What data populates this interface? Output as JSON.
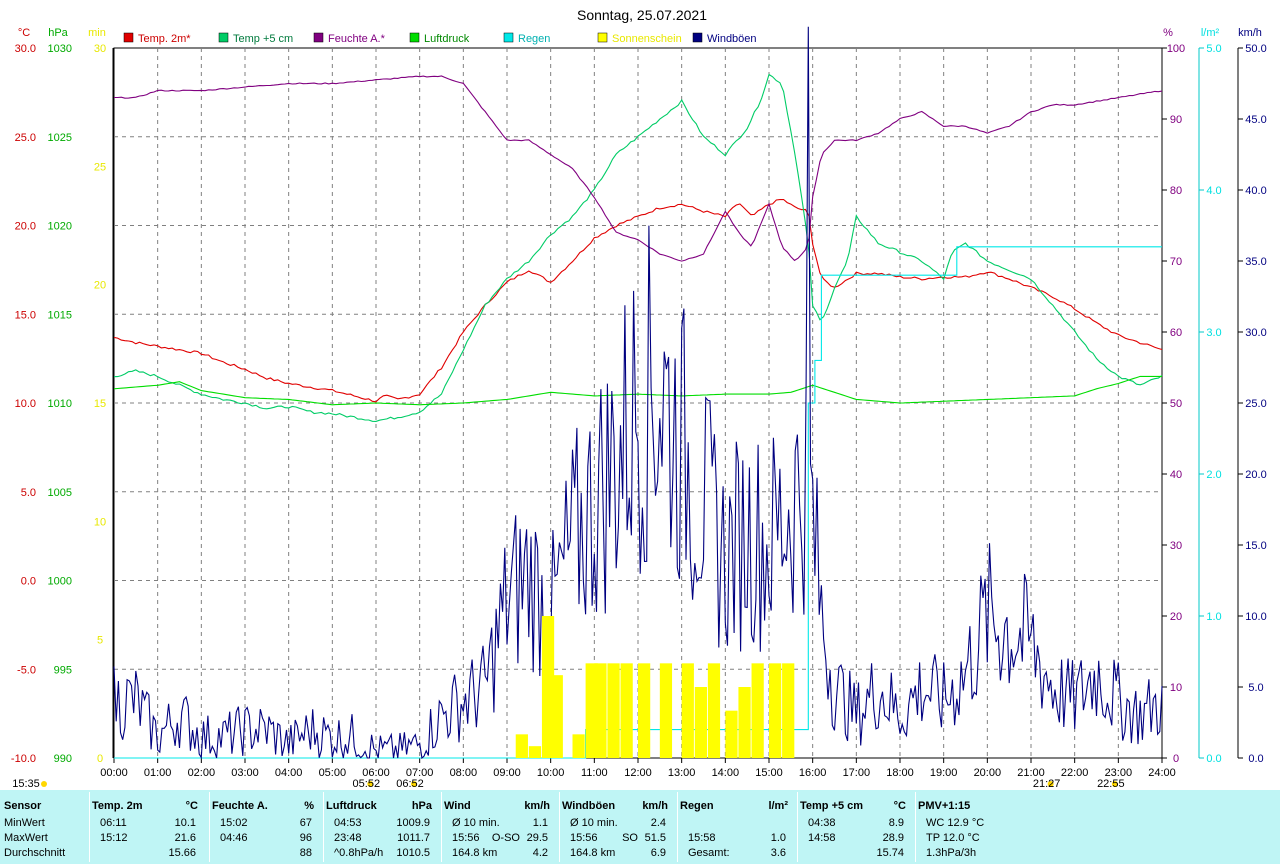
{
  "chart_data": {
    "type": "line",
    "title": "Sonntag, 25.07.2021",
    "x_ticks": [
      "00:00",
      "01:00",
      "02:00",
      "03:00",
      "04:00",
      "05:00",
      "06:00",
      "07:00",
      "08:00",
      "09:00",
      "10:00",
      "11:00",
      "12:00",
      "13:00",
      "14:00",
      "15:00",
      "16:00",
      "17:00",
      "18:00",
      "19:00",
      "20:00",
      "21:00",
      "22:00",
      "23:00",
      "24:00"
    ],
    "axes": {
      "temp_c": {
        "unit": "°C",
        "ylim": [
          -10,
          30
        ],
        "ticks": [
          "30.0",
          "25.0",
          "20.0",
          "15.0",
          "10.0",
          "5.0",
          "0.0",
          "-5.0",
          "-10.0"
        ],
        "color": "#cc0000"
      },
      "pressure_hpa": {
        "unit": "hPa",
        "ylim": [
          990,
          1030
        ],
        "ticks": [
          "1030",
          "1025",
          "1020",
          "1015",
          "1010",
          "1005",
          "1000",
          "995",
          "990"
        ],
        "color": "#00aa00"
      },
      "sunshine_min": {
        "unit": "min",
        "ylim": [
          0,
          30
        ],
        "ticks": [
          "30",
          "25",
          "20",
          "15",
          "10",
          "5",
          "0"
        ],
        "color": "#e8e800"
      },
      "humidity_pct": {
        "unit": "%",
        "ylim": [
          0,
          100
        ],
        "ticks": [
          "100",
          "90",
          "80",
          "70",
          "60",
          "50",
          "40",
          "30",
          "20",
          "10",
          "0"
        ],
        "color": "#800080"
      },
      "rain_lm2": {
        "unit": "l/m²",
        "ylim": [
          0,
          5
        ],
        "ticks": [
          "5.0",
          "4.0",
          "3.0",
          "2.0",
          "1.0",
          "0.0"
        ],
        "color": "#00e0e0"
      },
      "wind_kmh": {
        "unit": "km/h",
        "ylim": [
          0,
          50
        ],
        "ticks": [
          "50.0",
          "45.0",
          "40.0",
          "35.0",
          "30.0",
          "25.0",
          "20.0",
          "15.0",
          "10.0",
          "5.0",
          "0.0"
        ],
        "color": "#000080"
      }
    },
    "legend": [
      {
        "name": "Temp. 2m*",
        "color": "#e00000",
        "label_color": "#cc0000"
      },
      {
        "name": "Temp +5 cm",
        "color": "#00cc66",
        "label_color": "#007a3d"
      },
      {
        "name": "Feuchte A.*",
        "color": "#800080",
        "label_color": "#800080"
      },
      {
        "name": "Luftdruck",
        "color": "#00dd00",
        "label_color": "#008800"
      },
      {
        "name": "Regen",
        "color": "#00e8e8",
        "label_color": "#00b0b0"
      },
      {
        "name": "Sonnenschein",
        "color": "#ffff00",
        "label_color": "#e8e800"
      },
      {
        "name": "Windböen",
        "color": "#000080",
        "label_color": "#000080"
      }
    ],
    "series": [
      {
        "name": "Temp. 2m*",
        "axis": "temp_c",
        "color": "#e00000",
        "x": [
          0,
          0.5,
          1,
          1.5,
          2,
          2.5,
          3,
          3.5,
          4,
          4.5,
          5,
          5.5,
          6,
          6.2,
          6.5,
          7,
          7.5,
          8,
          8.5,
          9,
          9.5,
          10,
          10.5,
          11,
          11.5,
          12,
          12.5,
          13,
          13.5,
          14,
          14.3,
          14.6,
          15,
          15.3,
          15.6,
          15.9,
          16,
          16.2,
          16.5,
          17,
          17.5,
          18,
          18.5,
          19,
          19.5,
          20,
          20.5,
          21,
          21.5,
          22,
          22.5,
          23,
          23.5,
          24
        ],
        "y": [
          13.7,
          13.4,
          13.2,
          13.0,
          12.8,
          12.3,
          11.9,
          11.4,
          11.1,
          10.9,
          10.7,
          10.4,
          10.1,
          10.4,
          10.2,
          10.5,
          12.0,
          14.0,
          15.5,
          16.8,
          17.5,
          16.8,
          18.0,
          19.3,
          20.0,
          20.5,
          21.0,
          21.2,
          20.8,
          20.5,
          21.3,
          20.5,
          21.2,
          21.5,
          21.0,
          20.8,
          19.0,
          17.0,
          16.5,
          17.3,
          17.3,
          17.1,
          17.0,
          17.1,
          17.1,
          17.4,
          17.0,
          16.5,
          16.0,
          15.3,
          14.5,
          13.8,
          13.4,
          13.0
        ]
      },
      {
        "name": "Temp +5 cm",
        "axis": "temp_c",
        "color": "#00cc66",
        "x": [
          0,
          0.5,
          1,
          1.5,
          2,
          2.5,
          3,
          3.5,
          4,
          4.5,
          5,
          5.5,
          6,
          6.5,
          7,
          7.5,
          8,
          8.5,
          9,
          9.5,
          10,
          10.5,
          11,
          11.5,
          12,
          12.5,
          13,
          13.5,
          14,
          14.5,
          14.8,
          15,
          15.3,
          15.6,
          15.9,
          16,
          16.2,
          16.5,
          16.8,
          17,
          17.5,
          18,
          18.5,
          19,
          19.2,
          19.5,
          20,
          20.5,
          21,
          21.5,
          22,
          22.5,
          23,
          23.5,
          24
        ],
        "y": [
          11.5,
          11.8,
          11.5,
          11.0,
          10.5,
          10.2,
          10.0,
          9.7,
          9.8,
          9.5,
          9.4,
          9.2,
          9.0,
          9.2,
          9.5,
          10.5,
          13.0,
          15.5,
          17.0,
          18.0,
          19.5,
          20.5,
          22.0,
          24.0,
          25.0,
          26.0,
          27.0,
          25.0,
          24.0,
          25.5,
          27.0,
          28.5,
          28.0,
          24.0,
          19.0,
          15.5,
          14.5,
          16.5,
          18.0,
          20.5,
          19.0,
          18.5,
          18.0,
          17.0,
          18.5,
          19.0,
          18.0,
          17.5,
          17.0,
          15.5,
          14.0,
          12.5,
          11.5,
          11.0,
          11.5
        ]
      },
      {
        "name": "Feuchte A.*",
        "axis": "humidity_pct",
        "color": "#800080",
        "x": [
          0,
          0.5,
          1,
          2,
          3,
          4,
          5,
          6,
          7,
          7.5,
          8,
          8.5,
          9,
          9.5,
          10,
          10.5,
          11,
          11.5,
          12,
          12.5,
          13,
          13.5,
          14,
          14.3,
          14.6,
          15,
          15.3,
          15.6,
          15.9,
          16,
          16.2,
          16.5,
          17,
          17.5,
          18,
          18.5,
          19,
          19.5,
          20,
          20.5,
          21,
          21.5,
          22,
          22.5,
          23,
          23.5,
          24
        ],
        "y": [
          93,
          93,
          94,
          94,
          94.5,
          95,
          95,
          95.5,
          96,
          96,
          95,
          91,
          87,
          87,
          85,
          83,
          79,
          74,
          73,
          71,
          70,
          71,
          77,
          74,
          72,
          78,
          72,
          70,
          72,
          79,
          85,
          87,
          87,
          88,
          90,
          91,
          89,
          89,
          88,
          89,
          91,
          92,
          92,
          92.5,
          93,
          93.5,
          94
        ]
      },
      {
        "name": "Luftdruck",
        "axis": "pressure_hpa",
        "color": "#00dd00",
        "x": [
          0,
          1,
          1.5,
          2,
          3,
          4,
          5,
          6,
          7,
          8,
          9,
          10,
          11,
          12,
          13,
          14,
          15,
          15.5,
          16,
          16.5,
          17,
          18,
          19,
          20,
          21,
          22,
          22.5,
          23,
          23.5,
          24
        ],
        "y": [
          1010.8,
          1011.0,
          1011.2,
          1010.7,
          1010.3,
          1010.2,
          1009.9,
          1010.0,
          1009.9,
          1010.0,
          1010.2,
          1010.6,
          1010.4,
          1010.5,
          1010.4,
          1010.5,
          1010.5,
          1010.6,
          1011.0,
          1010.6,
          1010.2,
          1010.0,
          1010.1,
          1010.2,
          1010.3,
          1010.4,
          1010.8,
          1011.1,
          1011.5,
          1011.5
        ]
      },
      {
        "name": "Regen",
        "axis": "rain_lm2",
        "color": "#00e8e8",
        "step": true,
        "x": [
          0,
          10.8,
          10.8,
          15.9,
          15.9,
          16.05,
          16.2,
          16.5,
          19.2,
          19.3,
          24
        ],
        "y": [
          0,
          0,
          0.2,
          0.2,
          2.5,
          2.8,
          3.4,
          3.4,
          3.4,
          3.6,
          3.6
        ]
      },
      {
        "name": "Windböen",
        "axis": "wind_kmh",
        "color": "#000080",
        "jagged": true,
        "spike_x": 15.9,
        "spike_y": 51.5,
        "x": [
          0,
          0.5,
          1,
          1.5,
          2,
          2.5,
          3,
          3.5,
          4,
          4.5,
          5,
          5.5,
          6,
          6.5,
          7,
          7.5,
          8,
          8.5,
          9,
          9.5,
          10,
          10.5,
          11,
          11.5,
          12,
          12.5,
          13,
          13.5,
          14,
          14.5,
          15,
          15.5,
          15.9,
          16.2,
          16.5,
          17,
          17.5,
          18,
          18.5,
          19,
          19.5,
          20,
          20.5,
          21,
          21.5,
          22,
          22.5,
          23,
          23.5,
          24
        ],
        "y": [
          4,
          4,
          1.5,
          3,
          1.5,
          1.5,
          2,
          2,
          1,
          2,
          1.5,
          1.5,
          0.5,
          0.5,
          1,
          3,
          4,
          5,
          11,
          13,
          10,
          15,
          18,
          21,
          25,
          26,
          22,
          18,
          14,
          16,
          15,
          18,
          20,
          10,
          5,
          3,
          5,
          3,
          5,
          4,
          6,
          10,
          9,
          8,
          5,
          4,
          6,
          4,
          3,
          4
        ]
      },
      {
        "name": "Sonnenschein",
        "axis": "sunshine_min",
        "type": "bar",
        "color": "#ffff00",
        "x": [
          9.2,
          9.5,
          9.8,
          10.0,
          10.5,
          10.8,
          11.0,
          11.3,
          11.6,
          12.0,
          12.5,
          13.0,
          13.3,
          13.6,
          14.0,
          14.3,
          14.6,
          15.0,
          15.3
        ],
        "y": [
          1,
          0.5,
          6,
          3.5,
          1,
          4,
          4,
          4,
          4,
          4,
          4,
          4,
          3,
          4,
          2,
          3,
          4,
          4,
          4
        ]
      }
    ],
    "markers": [
      {
        "label": "05:52",
        "x": 5.87,
        "color": "#ffd700"
      },
      {
        "label": "06:52",
        "x": 6.87,
        "color": "#ffd700"
      },
      {
        "label": "15:35",
        "x": 0,
        "color": "#ffd700"
      },
      {
        "label": "21:27",
        "x": 21.45,
        "color": "#ffd700"
      },
      {
        "label": "22:55",
        "x": 22.92,
        "color": "#ffd700"
      }
    ]
  },
  "stats": {
    "sections": [
      {
        "title": "Sensor",
        "unit": "",
        "rows": [
          [
            "",
            "MinWert",
            ""
          ],
          [
            "",
            "MaxWert",
            ""
          ],
          [
            "",
            "Durchschnitt",
            ""
          ]
        ]
      },
      {
        "title": "Temp. 2m",
        "unit": "°C",
        "rows": [
          [
            "06:11",
            "",
            "10.1"
          ],
          [
            "15:12",
            "",
            "21.6"
          ],
          [
            "",
            "",
            "15.66"
          ]
        ]
      },
      {
        "title": "Feuchte A.",
        "unit": "%",
        "rows": [
          [
            "15:02",
            "",
            "67"
          ],
          [
            "04:46",
            "",
            "96"
          ],
          [
            "",
            "",
            "88"
          ]
        ]
      },
      {
        "title": "Luftdruck",
        "unit": "hPa",
        "rows": [
          [
            "04:53",
            "",
            "1009.9"
          ],
          [
            "23:48",
            "",
            "1011.7"
          ],
          [
            "^0.8hPa/h",
            "",
            "1010.5"
          ]
        ]
      },
      {
        "title": "Wind",
        "unit": "km/h",
        "rows": [
          [
            "Ø 10 min.",
            "",
            "1.1"
          ],
          [
            "15:56",
            "O-SO",
            "29.5"
          ],
          [
            "164.8 km",
            "",
            "4.2"
          ]
        ]
      },
      {
        "title": "Windböen",
        "unit": "km/h",
        "rows": [
          [
            "Ø 10 min.",
            "",
            "2.4"
          ],
          [
            "15:56",
            "SO",
            "51.5"
          ],
          [
            "164.8 km",
            "",
            "6.9"
          ]
        ]
      },
      {
        "title": "Regen",
        "unit": "l/m²",
        "rows": [
          [
            "",
            "",
            ""
          ],
          [
            "15:58",
            "",
            "1.0"
          ],
          [
            "Gesamt:",
            "",
            "3.6"
          ]
        ]
      },
      {
        "title": "Temp +5 cm",
        "unit": "°C",
        "rows": [
          [
            "04:38",
            "",
            "8.9"
          ],
          [
            "14:58",
            "",
            "28.9"
          ],
          [
            "",
            "",
            "15.74"
          ]
        ]
      },
      {
        "title": "PMV+1:15",
        "unit": "",
        "rows": [
          [
            "WC 12.9 °C",
            "",
            ""
          ],
          [
            "TP 12.0 °C",
            "",
            ""
          ],
          [
            "1.3hPa/3h",
            "",
            ""
          ]
        ]
      }
    ]
  }
}
